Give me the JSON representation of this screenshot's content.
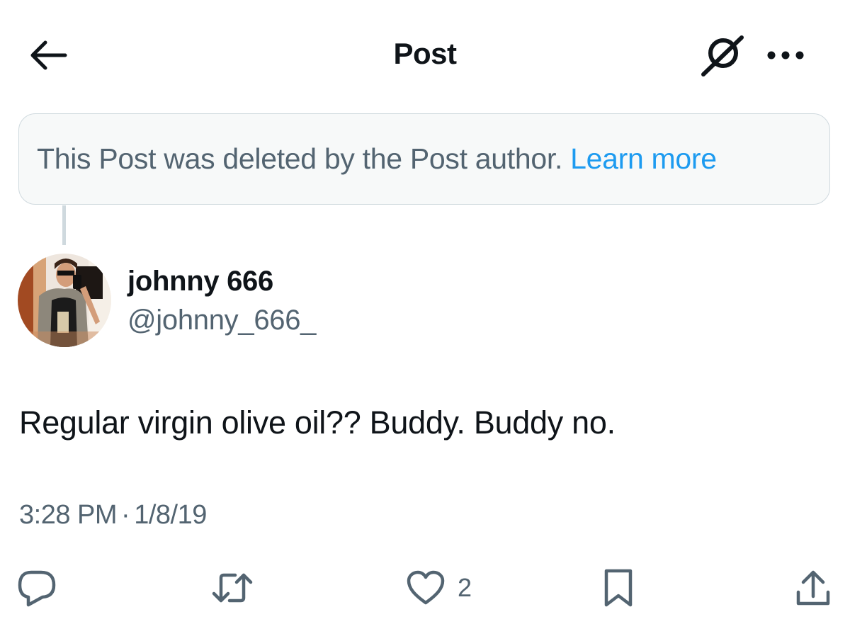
{
  "header": {
    "title": "Post",
    "back_icon": "arrow-left-icon",
    "grok_icon": "grok-icon",
    "more_icon": "more-horizontal-icon"
  },
  "notice": {
    "text": "This Post was deleted by the Post author.",
    "link": "Learn more"
  },
  "author": {
    "name": "johnny 666",
    "handle": "@johnny_666_"
  },
  "post": {
    "text": "Regular virgin olive oil?? Buddy. Buddy no.",
    "time": "3:28 PM",
    "separator": "·",
    "date": "1/8/19"
  },
  "actions": {
    "reply_icon": "reply-icon",
    "repost_icon": "repost-icon",
    "like_icon": "heart-icon",
    "like_count": "2",
    "bookmark_icon": "bookmark-icon",
    "share_icon": "share-icon"
  },
  "colors": {
    "text": "#0f1419",
    "secondary": "#536471",
    "link": "#1d9bf0",
    "notice_bg": "#f7f9f9",
    "border": "#cfd9de"
  }
}
